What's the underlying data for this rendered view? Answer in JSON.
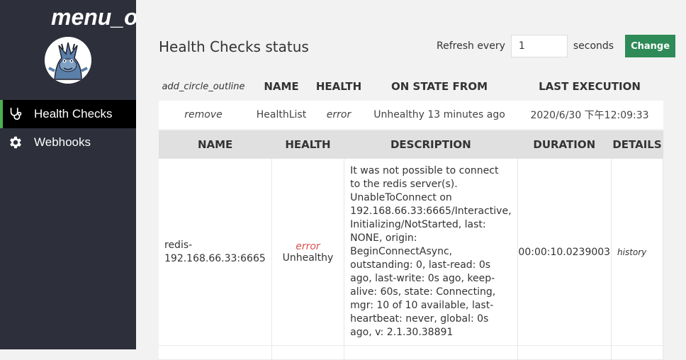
{
  "sidebar": {
    "menu_title": "menu_op",
    "items": [
      {
        "label": "Health Checks",
        "icon": "stethoscope-icon",
        "active": true
      },
      {
        "label": "Webhooks",
        "icon": "gear-icon",
        "active": false
      }
    ]
  },
  "header": {
    "title": "Health Checks status",
    "refresh_prefix": "Refresh every",
    "refresh_value": "1",
    "refresh_suffix": "seconds",
    "change_label": "Change"
  },
  "summary_table": {
    "columns": [
      "add_circle_outline",
      "NAME",
      "HEALTH",
      "ON STATE FROM",
      "LAST EXECUTION"
    ],
    "row": {
      "toggle": "remove",
      "name": "HealthList",
      "health": "error",
      "state_from": "Unhealthy 13 minutes ago",
      "last_execution": "2020/6/30 下午12:09:33"
    }
  },
  "detail_table": {
    "columns": [
      "NAME",
      "HEALTH",
      "DESCRIPTION",
      "DURATION",
      "DETAILS"
    ],
    "rows": [
      {
        "name": "redis-192.168.66.33:6665",
        "health_icon": "error",
        "health_text": "Unhealthy",
        "description": "It was not possible to connect to the redis server(s). UnableToConnect on 192.168.66.33:6665/Interactive, Initializing/NotStarted, last: NONE, origin: BeginConnectAsync, outstanding: 0, last-read: 0s ago, last-write: 0s ago, keep-alive: 60s, state: Connecting, mgr: 10 of 10 available, last-heartbeat: never, global: 0s ago, v: 2.1.30.38891",
        "duration": "00:00:10.0239003",
        "details": "history"
      }
    ]
  },
  "colors": {
    "sidebar_bg": "#2d2f3b",
    "accent_green": "#2e8b57",
    "error_red": "#d9534f",
    "active_border": "#4caf50"
  }
}
